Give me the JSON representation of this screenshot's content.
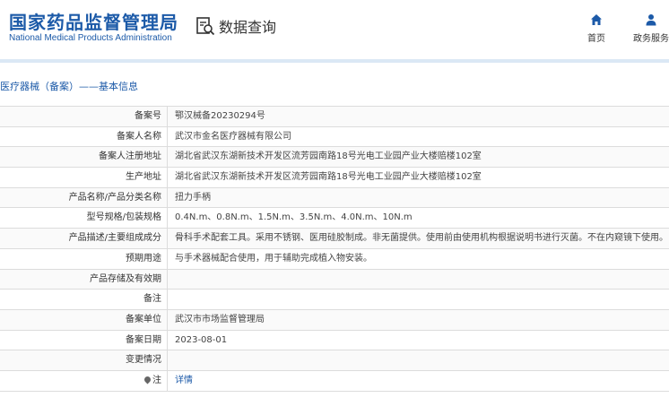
{
  "header": {
    "logo_cn": "国家药品监督管理局",
    "logo_en": "National Medical Products Administration",
    "query_label": "数据查询",
    "nav": [
      {
        "label": "首页",
        "icon": "home-icon"
      },
      {
        "label": "政务服务",
        "icon": "user-icon"
      }
    ]
  },
  "breadcrumb": "医疗器械（备案）——基本信息",
  "rows": [
    {
      "key": "备案号",
      "value": "鄂汉械备20230294号"
    },
    {
      "key": "备案人名称",
      "value": "武汉市金名医疗器械有限公司"
    },
    {
      "key": "备案人注册地址",
      "value": "湖北省武汉东湖新技术开发区流芳园南路18号光电工业园产业大楼赔楼102室"
    },
    {
      "key": "生产地址",
      "value": "湖北省武汉东湖新技术开发区流芳园南路18号光电工业园产业大楼赔楼102室"
    },
    {
      "key": "产品名称/产品分类名称",
      "value": "扭力手柄"
    },
    {
      "key": "型号规格/包装规格",
      "value": "0.4N.m、0.8N.m、1.5N.m、3.5N.m、4.0N.m、10N.m"
    },
    {
      "key": "产品描述/主要组成成分",
      "value": "骨科手术配套工具。采用不锈钢、医用硅胶制成。非无菌提供。使用前由使用机构根据说明书进行灭菌。不在内窥镜下使用。"
    },
    {
      "key": "预期用途",
      "value": "与手术器械配合使用，用于辅助完成植入物安装。"
    },
    {
      "key": "产品存储及有效期",
      "value": ""
    },
    {
      "key": "备注",
      "value": ""
    },
    {
      "key": "备案单位",
      "value": "武汉市市场监督管理局"
    },
    {
      "key": "备案日期",
      "value": "2023-08-01"
    },
    {
      "key": "变更情况",
      "value": ""
    },
    {
      "key": "注",
      "value": "详情"
    }
  ]
}
